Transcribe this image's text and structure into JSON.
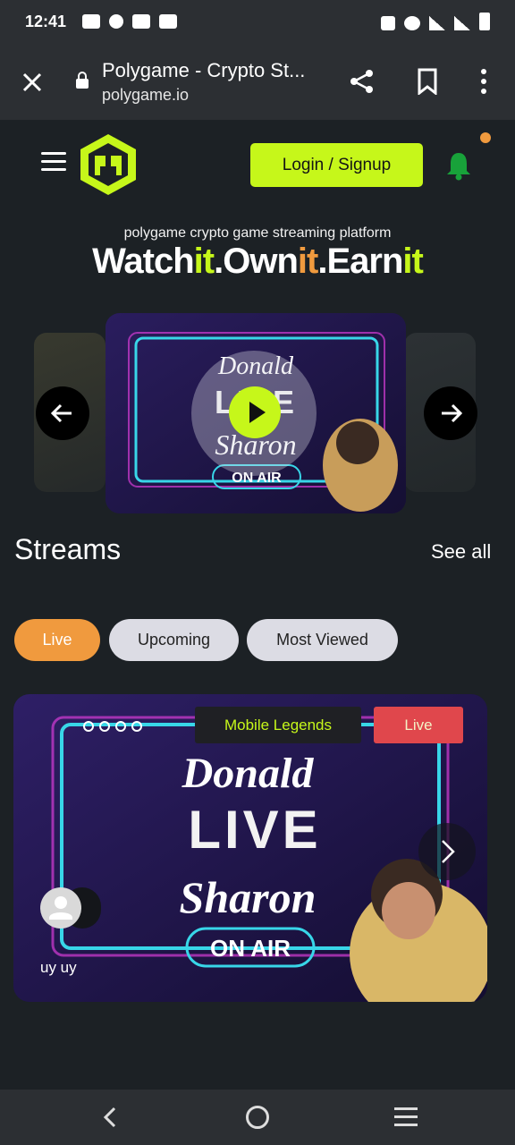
{
  "status": {
    "time": "12:41"
  },
  "browser": {
    "title": "Polygame - Crypto St...",
    "host": "polygame.io"
  },
  "header": {
    "login_label": "Login / Signup"
  },
  "hero": {
    "tagline": "polygame crypto game streaming platform",
    "watch": "Watch",
    "it1": "it",
    "dot1": ".",
    "own": "Own",
    "it2": "it",
    "dot2": ".",
    "earn": "Earn",
    "it3": "it"
  },
  "streams": {
    "title": "Streams",
    "see_all": "See all",
    "tabs": [
      "Live",
      "Upcoming",
      "Most Viewed"
    ],
    "card": {
      "game": "Mobile Legends",
      "status": "Live",
      "streamer": "uy uy"
    }
  },
  "colors": {
    "accent_green": "#c6f71a",
    "accent_orange": "#f09a3e",
    "live_red": "#e0474c",
    "background": "#1c2125"
  }
}
